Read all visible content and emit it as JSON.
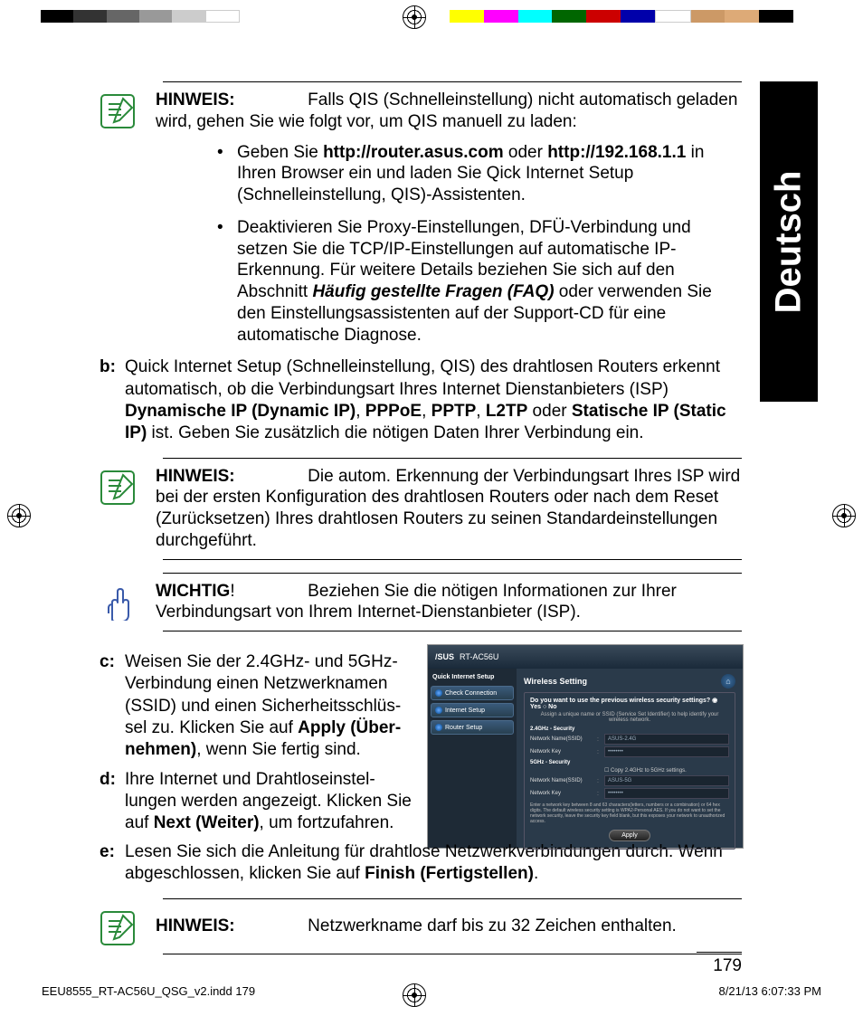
{
  "language_tab": "Deutsch",
  "note1": {
    "label": "HINWEIS:",
    "text": "Falls QIS (Schnelleinstellung) nicht automatisch gela­den wird, gehen Sie wie folgt vor, um QIS manuell zu laden:"
  },
  "bullets": [
    {
      "pre": "Geben Sie ",
      "b1": "http://router.asus.com",
      "mid": " oder ",
      "b2": "http://192.168.1.1",
      "post": " in Ihren Browser ein und laden Sie Qick Internet Setup (Schnelleinstellung, QIS)-Assistenten."
    },
    {
      "pre": "Deaktivieren Sie Proxy-Einstellungen, DFÜ-Verbindung und setzen Sie die TCP/IP-Einstellungen auf automatische IP-Erkennung. Für weitere Details beziehen Sie sich auf den Abschnitt ",
      "bi": "Häufig gestellte Fragen (FAQ)",
      "post": " oder verwenden Sie den Einstellungsassistenten auf der Support-CD für eine automatische Diagnose."
    }
  ],
  "step_b": {
    "label": "b:",
    "pre": "Quick Internet Setup (Schnelleinstellung, QIS) des drahtlosen Routers erkennt automatisch, ob die Verbindungsart Ihres Internet Dienstanbieters (ISP) ",
    "b1": "Dynamische IP (Dynamic IP)",
    "s1": ", ",
    "b2": "PPPoE",
    "s2": ", ",
    "b3": "PPTP",
    "s3": ", ",
    "b4": "L2TP",
    "s4": " oder ",
    "b5": "Statische IP (Static IP)",
    "post": " ist. Geben Sie zusätzlich die nötigen Daten Ihrer Verbindung ein."
  },
  "note2": {
    "label": "HINWEIS:",
    "text": "Die autom. Erkennung der Verbindungsart Ihres ISP wird bei der ersten Konfiguration des drahtlosen Routers oder nach dem Reset (Zurücksetzen) Ihres drahtlosen Routers zu seinen Stan­dardeinstellungen durchgeführt."
  },
  "important": {
    "label": "WICHTIG",
    "bang": "!",
    "text": "Beziehen Sie die nötigen Informationen zur Ihrer Verbindungsart von Ihrem Internet-Dienstanbieter (ISP)."
  },
  "step_c": {
    "label": "c:",
    "pre": "Weisen Sie der 2.4GHz- und 5GHz-Verbindung einen Netzwerknamen (SSID) und einen Sicherheitsschlüs­sel zu. Klicken Sie auf ",
    "b": "Apply (Über­nehmen)",
    "post": ", wenn Sie fertig sind."
  },
  "step_d": {
    "label": "d:",
    "pre": "Ihre Internet und Drahtloseinstel­lungen werden angezeigt. Klicken Sie auf ",
    "b": "Next (Weiter)",
    "post": ", um fortzufah­ren."
  },
  "step_e": {
    "label": "e:",
    "pre": "Lesen Sie sich die Anleitung für drahtlose Netzwerkverbindungen durch. Wenn abgeschlossen, klicken Sie auf ",
    "b": "Finish (Fertigstellen)",
    "post": "."
  },
  "note3": {
    "label": "HINWEIS:",
    "text": "Netzwerkname darf bis zu 32 Zeichen enthalten."
  },
  "screenshot": {
    "brand": "/SUS",
    "model": "RT-AC56U",
    "side_title": "Quick Internet Setup",
    "side_items": [
      "Check Connection",
      "Internet Setup",
      "Router Setup"
    ],
    "main_title": "Wireless Setting",
    "question": "Do you want to use the previous wireless security settings?  ◉ Yes  ○ No",
    "subtext": "Assign a unique name or SSID (Service Set Identifier) to help identify your wireless network.",
    "sect24": "2.4GHz - Security",
    "sect5": "5GHz - Security",
    "lbl_name": "Network Name(SSID)",
    "lbl_key": "Network Key",
    "val_name24": "ASUS-2.4G",
    "val_key": "••••••••",
    "copy": "Copy 2.4GHz to 5GHz settings.",
    "val_name5": "ASUS-5G",
    "footer": "Enter a network key between 8 and 63 characters(letters, numbers or a combination) or 64 hex digits. The default wireless security setting is WPA2-Personal AES. If you do not want to set the network security, leave the security key field blank, but this exposes your network to unauthorized access.",
    "apply": "Apply"
  },
  "page_number": "179",
  "footer_left": "EEU8555_RT-AC56U_QSG_v2.indd   179",
  "footer_right": "8/21/13   6:07:33 PM"
}
